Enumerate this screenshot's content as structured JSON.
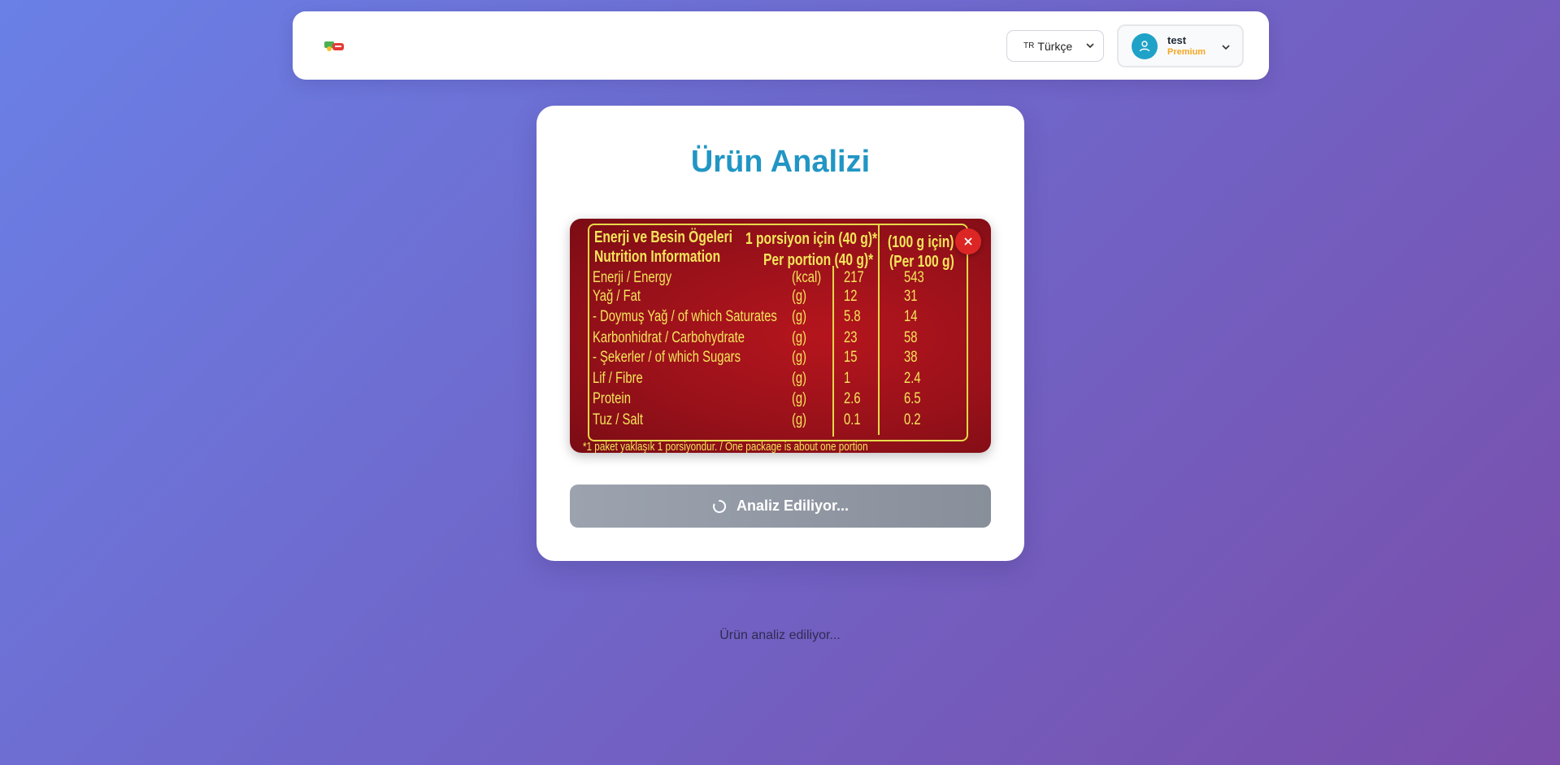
{
  "header": {
    "language": {
      "flag": "TR",
      "label": "Türkçe"
    },
    "user": {
      "name": "test",
      "plan": "Premium"
    }
  },
  "card": {
    "title": "Ürün Analizi",
    "image": {
      "heading_tr": "Enerji ve Besin Ögeleri",
      "heading_en": "Nutrition Information",
      "portion_tr": "1 porsiyon için (40 g)*",
      "portion_en": "Per portion (40 g)*",
      "per100_tr": "(100 g için)",
      "per100_en": "(Per 100 g)",
      "rows": [
        {
          "name": "Enerji / Energy",
          "unit": "(kcal)",
          "portion": "217",
          "per100": "543"
        },
        {
          "name": "Yağ / Fat",
          "unit": "(g)",
          "portion": "12",
          "per100": "31"
        },
        {
          "name": "- Doymuş Yağ / of which Saturates",
          "unit": "(g)",
          "portion": "5.8",
          "per100": "14"
        },
        {
          "name": "Karbonhidrat / Carbohydrate",
          "unit": "(g)",
          "portion": "23",
          "per100": "58"
        },
        {
          "name": "- Şekerler / of which Sugars",
          "unit": "(g)",
          "portion": "15",
          "per100": "38"
        },
        {
          "name": "Lif / Fibre",
          "unit": "(g)",
          "portion": "1",
          "per100": "2.4"
        },
        {
          "name": "Protein",
          "unit": "(g)",
          "portion": "2.6",
          "per100": "6.5"
        },
        {
          "name": "Tuz / Salt",
          "unit": "(g)",
          "portion": "0.1",
          "per100": "0.2"
        }
      ],
      "footnote": "*1 paket yaklaşık 1 porsiyondur. / One package is about one portion"
    },
    "analyze_button": "Analiz Ediliyor..."
  },
  "status": "Ürün analiz ediliyor...",
  "colors": {
    "title": "#2196c4",
    "plan": "#f5a623",
    "close": "#dc2626",
    "label_text": "#f3e55a"
  }
}
